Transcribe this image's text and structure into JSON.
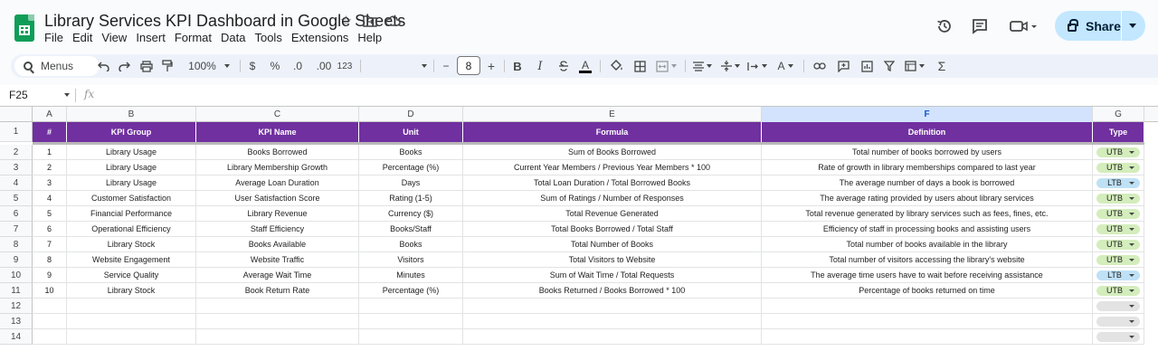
{
  "document": {
    "title": "Library Services KPI Dashboard in Google Sheets"
  },
  "menu": [
    "File",
    "Edit",
    "View",
    "Insert",
    "Format",
    "Data",
    "Tools",
    "Extensions",
    "Help"
  ],
  "share": {
    "label": "Share"
  },
  "toolbar": {
    "search_label": "Menus",
    "zoom": "100%",
    "currency": "$",
    "percent": "%",
    "dec_decrease": ".0",
    "dec_increase": ".00",
    "number_format": "123",
    "font_size": "8",
    "minus": "−",
    "plus": "+",
    "bold": "B",
    "italic": "I",
    "text_color": "A",
    "sum": "Σ"
  },
  "formula_bar": {
    "cell_ref": "F25",
    "fx": "fx"
  },
  "sheet": {
    "column_letters": [
      "A",
      "B",
      "C",
      "D",
      "E",
      "F",
      "G"
    ],
    "selected_column": "F",
    "row_numbers": [
      "1",
      "2",
      "3",
      "4",
      "5",
      "6",
      "7",
      "8",
      "9",
      "10",
      "11",
      "12",
      "13",
      "14"
    ],
    "headers": [
      "#",
      "KPI Group",
      "KPI Name",
      "Unit",
      "Formula",
      "Definition",
      "Type"
    ],
    "header_color": "#7030a0",
    "rows": [
      {
        "n": "1",
        "group": "Library Usage",
        "name": "Books Borrowed",
        "unit": "Books",
        "formula": "Sum of Books Borrowed",
        "definition": "Total number of books borrowed by users",
        "type": "UTB"
      },
      {
        "n": "2",
        "group": "Library Usage",
        "name": "Library Membership Growth",
        "unit": "Percentage (%)",
        "formula": "Current Year Members / Previous Year Members * 100",
        "definition": "Rate of growth in library memberships compared to last year",
        "type": "UTB"
      },
      {
        "n": "3",
        "group": "Library Usage",
        "name": "Average Loan Duration",
        "unit": "Days",
        "formula": "Total Loan Duration / Total Borrowed Books",
        "definition": "The average number of days a book is borrowed",
        "type": "LTB"
      },
      {
        "n": "4",
        "group": "Customer Satisfaction",
        "name": "User Satisfaction Score",
        "unit": "Rating (1-5)",
        "formula": "Sum of Ratings / Number of Responses",
        "definition": "The average rating provided by users about library services",
        "type": "UTB"
      },
      {
        "n": "5",
        "group": "Financial Performance",
        "name": "Library Revenue",
        "unit": "Currency ($)",
        "formula": "Total Revenue Generated",
        "definition": "Total revenue generated by library services such as fees, fines, etc.",
        "type": "UTB"
      },
      {
        "n": "6",
        "group": "Operational Efficiency",
        "name": "Staff Efficiency",
        "unit": "Books/Staff",
        "formula": "Total Books Borrowed / Total Staff",
        "definition": "Efficiency of staff in processing books and assisting users",
        "type": "UTB"
      },
      {
        "n": "7",
        "group": "Library Stock",
        "name": "Books Available",
        "unit": "Books",
        "formula": "Total Number of Books",
        "definition": "Total number of books available in the library",
        "type": "UTB"
      },
      {
        "n": "8",
        "group": "Website Engagement",
        "name": "Website Traffic",
        "unit": "Visitors",
        "formula": "Total Visitors to Website",
        "definition": "Total number of visitors accessing the library's website",
        "type": "UTB"
      },
      {
        "n": "9",
        "group": "Service Quality",
        "name": "Average Wait Time",
        "unit": "Minutes",
        "formula": "Sum of Wait Time / Total Requests",
        "definition": "The average time users have to wait before receiving assistance",
        "type": "LTB"
      },
      {
        "n": "10",
        "group": "Library Stock",
        "name": "Book Return Rate",
        "unit": "Percentage (%)",
        "formula": "Books Returned / Books Borrowed * 100",
        "definition": "Percentage of books returned on time",
        "type": "UTB"
      }
    ]
  }
}
